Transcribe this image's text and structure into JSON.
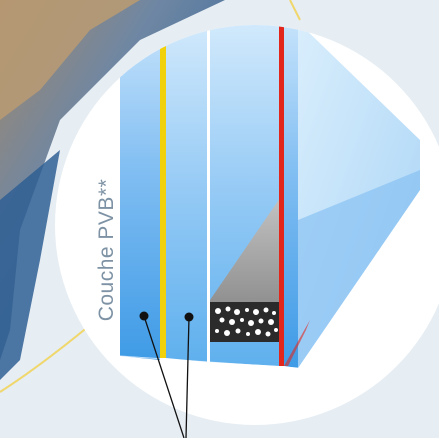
{
  "diagram": {
    "pvb_label": "Couche PVB**"
  },
  "colors": {
    "glass_light": "#bfe0fb",
    "glass_mid": "#8fc8f5",
    "glass_deep": "#4aa3ea",
    "pvb_interlayer": "#f1d10c",
    "warm_edge_spacer": "#e3261c",
    "spacer_grey": "#a4a4a4",
    "desiccant_dark": "#2b2b2b",
    "background_blue": "#4a78a8"
  }
}
